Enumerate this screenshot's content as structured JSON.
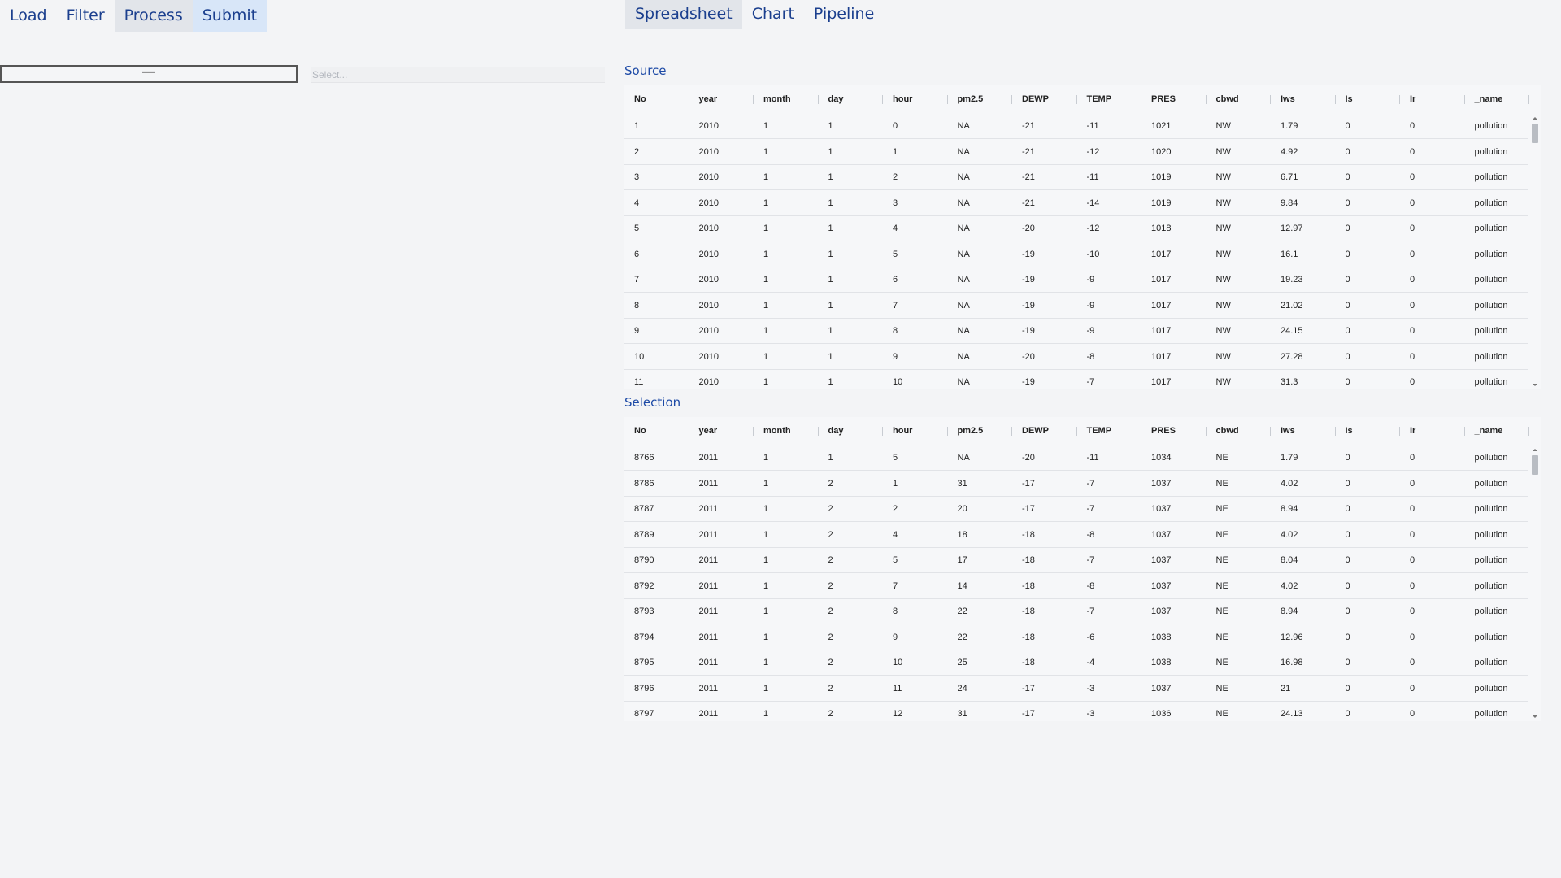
{
  "toolbar": {
    "load": "Load",
    "filter": "Filter",
    "process": "Process",
    "submit": "Submit"
  },
  "view_tabs": {
    "spreadsheet": "Spreadsheet",
    "chart": "Chart",
    "pipeline": "Pipeline"
  },
  "step_box": {
    "value": "—"
  },
  "select": {
    "placeholder": "Select..."
  },
  "columns": [
    "No",
    "year",
    "month",
    "day",
    "hour",
    "pm2.5",
    "DEWP",
    "TEMP",
    "PRES",
    "cbwd",
    "Iws",
    "Is",
    "Ir",
    "_name"
  ],
  "source": {
    "title": "Source",
    "rows": [
      [
        "1",
        "2010",
        "1",
        "1",
        "0",
        "NA",
        "-21",
        "-11",
        "1021",
        "NW",
        "1.79",
        "0",
        "0",
        "pollution"
      ],
      [
        "2",
        "2010",
        "1",
        "1",
        "1",
        "NA",
        "-21",
        "-12",
        "1020",
        "NW",
        "4.92",
        "0",
        "0",
        "pollution"
      ],
      [
        "3",
        "2010",
        "1",
        "1",
        "2",
        "NA",
        "-21",
        "-11",
        "1019",
        "NW",
        "6.71",
        "0",
        "0",
        "pollution"
      ],
      [
        "4",
        "2010",
        "1",
        "1",
        "3",
        "NA",
        "-21",
        "-14",
        "1019",
        "NW",
        "9.84",
        "0",
        "0",
        "pollution"
      ],
      [
        "5",
        "2010",
        "1",
        "1",
        "4",
        "NA",
        "-20",
        "-12",
        "1018",
        "NW",
        "12.97",
        "0",
        "0",
        "pollution"
      ],
      [
        "6",
        "2010",
        "1",
        "1",
        "5",
        "NA",
        "-19",
        "-10",
        "1017",
        "NW",
        "16.1",
        "0",
        "0",
        "pollution"
      ],
      [
        "7",
        "2010",
        "1",
        "1",
        "6",
        "NA",
        "-19",
        "-9",
        "1017",
        "NW",
        "19.23",
        "0",
        "0",
        "pollution"
      ],
      [
        "8",
        "2010",
        "1",
        "1",
        "7",
        "NA",
        "-19",
        "-9",
        "1017",
        "NW",
        "21.02",
        "0",
        "0",
        "pollution"
      ],
      [
        "9",
        "2010",
        "1",
        "1",
        "8",
        "NA",
        "-19",
        "-9",
        "1017",
        "NW",
        "24.15",
        "0",
        "0",
        "pollution"
      ],
      [
        "10",
        "2010",
        "1",
        "1",
        "9",
        "NA",
        "-20",
        "-8",
        "1017",
        "NW",
        "27.28",
        "0",
        "0",
        "pollution"
      ],
      [
        "11",
        "2010",
        "1",
        "1",
        "10",
        "NA",
        "-19",
        "-7",
        "1017",
        "NW",
        "31.3",
        "0",
        "0",
        "pollution"
      ]
    ]
  },
  "selection": {
    "title": "Selection",
    "rows": [
      [
        "8766",
        "2011",
        "1",
        "1",
        "5",
        "NA",
        "-20",
        "-11",
        "1034",
        "NE",
        "1.79",
        "0",
        "0",
        "pollution"
      ],
      [
        "8786",
        "2011",
        "1",
        "2",
        "1",
        "31",
        "-17",
        "-7",
        "1037",
        "NE",
        "4.02",
        "0",
        "0",
        "pollution"
      ],
      [
        "8787",
        "2011",
        "1",
        "2",
        "2",
        "20",
        "-17",
        "-7",
        "1037",
        "NE",
        "8.94",
        "0",
        "0",
        "pollution"
      ],
      [
        "8789",
        "2011",
        "1",
        "2",
        "4",
        "18",
        "-18",
        "-8",
        "1037",
        "NE",
        "4.02",
        "0",
        "0",
        "pollution"
      ],
      [
        "8790",
        "2011",
        "1",
        "2",
        "5",
        "17",
        "-18",
        "-7",
        "1037",
        "NE",
        "8.04",
        "0",
        "0",
        "pollution"
      ],
      [
        "8792",
        "2011",
        "1",
        "2",
        "7",
        "14",
        "-18",
        "-8",
        "1037",
        "NE",
        "4.02",
        "0",
        "0",
        "pollution"
      ],
      [
        "8793",
        "2011",
        "1",
        "2",
        "8",
        "22",
        "-18",
        "-7",
        "1037",
        "NE",
        "8.94",
        "0",
        "0",
        "pollution"
      ],
      [
        "8794",
        "2011",
        "1",
        "2",
        "9",
        "22",
        "-18",
        "-6",
        "1038",
        "NE",
        "12.96",
        "0",
        "0",
        "pollution"
      ],
      [
        "8795",
        "2011",
        "1",
        "2",
        "10",
        "25",
        "-18",
        "-4",
        "1038",
        "NE",
        "16.98",
        "0",
        "0",
        "pollution"
      ],
      [
        "8796",
        "2011",
        "1",
        "2",
        "11",
        "24",
        "-17",
        "-3",
        "1037",
        "NE",
        "21",
        "0",
        "0",
        "pollution"
      ],
      [
        "8797",
        "2011",
        "1",
        "2",
        "12",
        "31",
        "-17",
        "-3",
        "1036",
        "NE",
        "24.13",
        "0",
        "0",
        "pollution"
      ]
    ]
  }
}
